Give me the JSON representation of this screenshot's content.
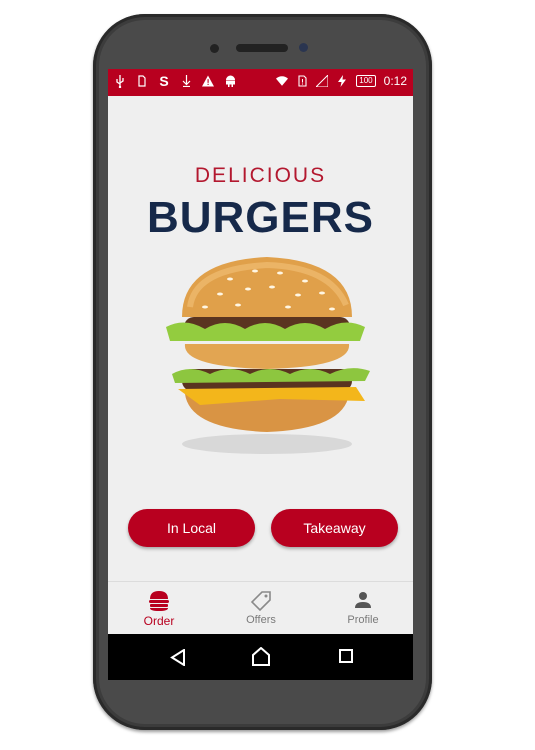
{
  "status_bar": {
    "left_icons": [
      "usb-icon",
      "sim-icon",
      "s-icon",
      "download-icon",
      "warning-icon",
      "android-icon"
    ],
    "right_icons": [
      "wifi-icon",
      "sim-alert-icon",
      "signal-icon",
      "charging-icon"
    ],
    "battery": "100",
    "time": "0:12"
  },
  "logo": {
    "line1": "DELICIOUS",
    "line2": "BURGERS"
  },
  "actions": {
    "in_local": "In Local",
    "takeaway": "Takeaway"
  },
  "tabs": [
    {
      "label": "Order",
      "icon": "burger-icon",
      "active": true
    },
    {
      "label": "Offers",
      "icon": "tag-icon",
      "active": false
    },
    {
      "label": "Profile",
      "icon": "person-icon",
      "active": false
    }
  ],
  "colors": {
    "brand_red": "#b8001f",
    "logo_navy": "#16294a",
    "screen_bg": "#efefef"
  }
}
